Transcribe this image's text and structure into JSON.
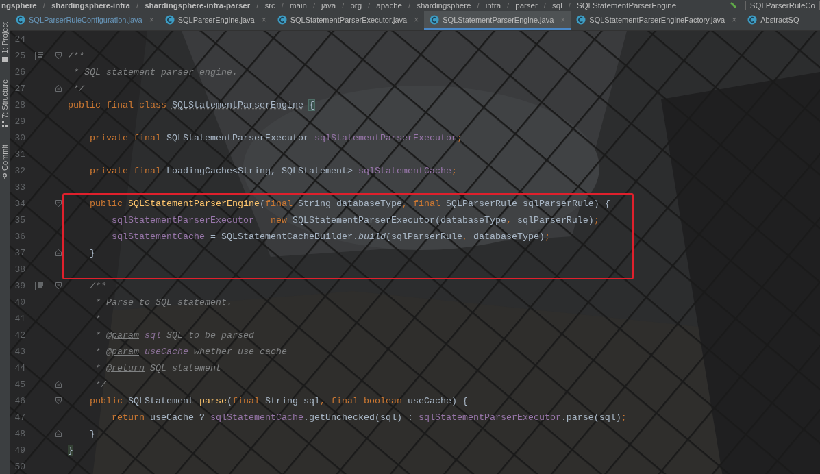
{
  "breadcrumb": [
    {
      "label": "ngsphere"
    },
    {
      "separator": "/",
      "label": "shardingsphere-infra"
    },
    {
      "separator": "/",
      "label": "shardingsphere-infra-parser"
    },
    {
      "separator": "/",
      "label": "src"
    },
    {
      "separator": "/",
      "label": "main"
    },
    {
      "separator": "/",
      "label": "java"
    },
    {
      "separator": "/",
      "label": "org"
    },
    {
      "separator": "/",
      "label": "apache"
    },
    {
      "separator": "/",
      "label": "shardingsphere"
    },
    {
      "separator": "/",
      "label": "infra"
    },
    {
      "separator": "/",
      "label": "parser"
    },
    {
      "separator": "/",
      "label": "sql"
    },
    {
      "separator": "/",
      "label": "SQLStatementParserEngine"
    }
  ],
  "breadcrumb_right": {
    "label": "SQLParserRuleCo"
  },
  "tool_windows": [
    {
      "label": "1: Project",
      "kind": "project"
    },
    {
      "label": "7: Structure",
      "kind": "structure"
    },
    {
      "label": "Commit",
      "kind": "commit"
    }
  ],
  "tabs": [
    {
      "label": "SQLParserRuleConfiguration.java",
      "close": "×",
      "selected": false,
      "modified": true
    },
    {
      "label": "SQLParserEngine.java",
      "close": "×",
      "selected": false,
      "modified": false
    },
    {
      "label": "SQLStatementParserExecutor.java",
      "close": "×",
      "selected": false,
      "modified": false
    },
    {
      "label": "SQLStatementParserEngine.java",
      "close": "×",
      "selected": true,
      "modified": false
    },
    {
      "label": "SQLStatementParserEngineFactory.java",
      "close": "×",
      "selected": false,
      "modified": false
    },
    {
      "label": "AbstractSQ",
      "selected": false,
      "modified": false
    }
  ],
  "editor": {
    "lines": [
      {
        "number": "24"
      },
      {
        "number": "25",
        "fold_start": true,
        "doc_icon": true,
        "tokens": [
          {
            "kind": "comment",
            "text": "/**"
          }
        ]
      },
      {
        "number": "26",
        "tokens": [
          {
            "kind": "comment",
            "text": " * SQL statement parser engine."
          }
        ]
      },
      {
        "number": "27",
        "fold_end": true,
        "tokens": [
          {
            "kind": "comment",
            "text": " */"
          }
        ]
      },
      {
        "number": "28",
        "tokens": [
          {
            "kind": "kw",
            "text": "public final class "
          },
          {
            "kind": "classname",
            "text": "SQLStatementParserEngine"
          },
          {
            "kind": "brace",
            "text": "{"
          }
        ]
      },
      {
        "number": "29"
      },
      {
        "number": "30",
        "tokens": [
          {
            "kind": "kw",
            "text": "    private final "
          },
          {
            "kind": "plain",
            "text": "SQLStatementParserExecutor "
          },
          {
            "kind": "field",
            "text": "sqlStatementParserExecutor"
          },
          {
            "kind": "kw",
            "text": ";"
          }
        ]
      },
      {
        "number": "31"
      },
      {
        "number": "32",
        "tokens": [
          {
            "kind": "kw",
            "text": "    private final "
          },
          {
            "kind": "plain",
            "text": "LoadingCache<String, SQLStatement> "
          },
          {
            "kind": "field",
            "text": "sqlStatementCache"
          },
          {
            "kind": "kw",
            "text": ";"
          }
        ]
      },
      {
        "number": "33"
      },
      {
        "number": "34",
        "fold_start": true,
        "boxed": true,
        "tokens": [
          {
            "kind": "kw",
            "text": "    public "
          },
          {
            "kind": "method",
            "text": "SQLStatementParserEngine"
          },
          {
            "kind": "plain",
            "text": "("
          },
          {
            "kind": "kw",
            "text": "final "
          },
          {
            "kind": "plain",
            "text": "String databaseType"
          },
          {
            "kind": "kw",
            "text": ", final "
          },
          {
            "kind": "plain",
            "text": "SQLParserRule sqlParserRule) {"
          }
        ]
      },
      {
        "number": "35",
        "boxed": true,
        "tokens": [
          {
            "kind": "field",
            "text": "        sqlStatementParserExecutor"
          },
          {
            "kind": "plain",
            "text": " = "
          },
          {
            "kind": "kw",
            "text": "new "
          },
          {
            "kind": "plain",
            "text": "SQLStatementParserExecutor(databaseType"
          },
          {
            "kind": "kw",
            "text": ", "
          },
          {
            "kind": "plain",
            "text": "sqlParserRule)"
          },
          {
            "kind": "kw",
            "text": ";"
          }
        ]
      },
      {
        "number": "36",
        "boxed": true,
        "tokens": [
          {
            "kind": "field",
            "text": "        sqlStatementCache"
          },
          {
            "kind": "plain",
            "text": " = SQLStatementCacheBuilder."
          },
          {
            "kind": "static",
            "text": "build"
          },
          {
            "kind": "plain",
            "text": "(sqlParserRule"
          },
          {
            "kind": "kw",
            "text": ", "
          },
          {
            "kind": "plain",
            "text": "databaseType)"
          },
          {
            "kind": "kw",
            "text": ";"
          }
        ]
      },
      {
        "number": "37",
        "fold_end": true,
        "boxed": true,
        "tokens": [
          {
            "kind": "plain",
            "text": "    }"
          }
        ]
      },
      {
        "number": "38",
        "boxed": true,
        "caret": true
      },
      {
        "number": "39",
        "fold_start": true,
        "doc_icon": true,
        "tokens": [
          {
            "kind": "comment",
            "text": "    /**"
          }
        ]
      },
      {
        "number": "40",
        "tokens": [
          {
            "kind": "comment",
            "text": "     * Parse to SQL statement."
          }
        ]
      },
      {
        "number": "41",
        "tokens": [
          {
            "kind": "comment",
            "text": "     *"
          }
        ]
      },
      {
        "number": "42",
        "tokens": [
          {
            "kind": "comment",
            "text": "     * "
          },
          {
            "kind": "tag",
            "text": "@param"
          },
          {
            "kind": "param",
            "text": " sql"
          },
          {
            "kind": "comment",
            "text": " SQL to be parsed"
          }
        ]
      },
      {
        "number": "43",
        "tokens": [
          {
            "kind": "comment",
            "text": "     * "
          },
          {
            "kind": "tag",
            "text": "@param"
          },
          {
            "kind": "param",
            "text": " useCache"
          },
          {
            "kind": "comment",
            "text": " whether use cache"
          }
        ]
      },
      {
        "number": "44",
        "tokens": [
          {
            "kind": "comment",
            "text": "     * "
          },
          {
            "kind": "tag",
            "text": "@return"
          },
          {
            "kind": "comment",
            "text": " SQL statement"
          }
        ]
      },
      {
        "number": "45",
        "fold_end": true,
        "tokens": [
          {
            "kind": "comment",
            "text": "     */"
          }
        ]
      },
      {
        "number": "46",
        "fold_start": true,
        "tokens": [
          {
            "kind": "kw",
            "text": "    public "
          },
          {
            "kind": "plain",
            "text": "SQLStatement "
          },
          {
            "kind": "method",
            "text": "parse"
          },
          {
            "kind": "plain",
            "text": "("
          },
          {
            "kind": "kw",
            "text": "final "
          },
          {
            "kind": "plain",
            "text": "String sql"
          },
          {
            "kind": "kw",
            "text": ", final boolean "
          },
          {
            "kind": "plain",
            "text": "useCache) {"
          }
        ]
      },
      {
        "number": "47",
        "tokens": [
          {
            "kind": "kw",
            "text": "        return "
          },
          {
            "kind": "plain",
            "text": "useCache ? "
          },
          {
            "kind": "field",
            "text": "sqlStatementCache"
          },
          {
            "kind": "plain",
            "text": ".getUnchecked(sql) : "
          },
          {
            "kind": "field",
            "text": "sqlStatementParserExecutor"
          },
          {
            "kind": "plain",
            "text": ".parse(sql)"
          },
          {
            "kind": "kw",
            "text": ";"
          }
        ]
      },
      {
        "number": "48",
        "fold_end": true,
        "tokens": [
          {
            "kind": "plain",
            "text": "    }"
          }
        ]
      },
      {
        "number": "49",
        "tokens": [
          {
            "kind": "brace2",
            "text": "}"
          }
        ]
      },
      {
        "number": "50"
      }
    ]
  }
}
